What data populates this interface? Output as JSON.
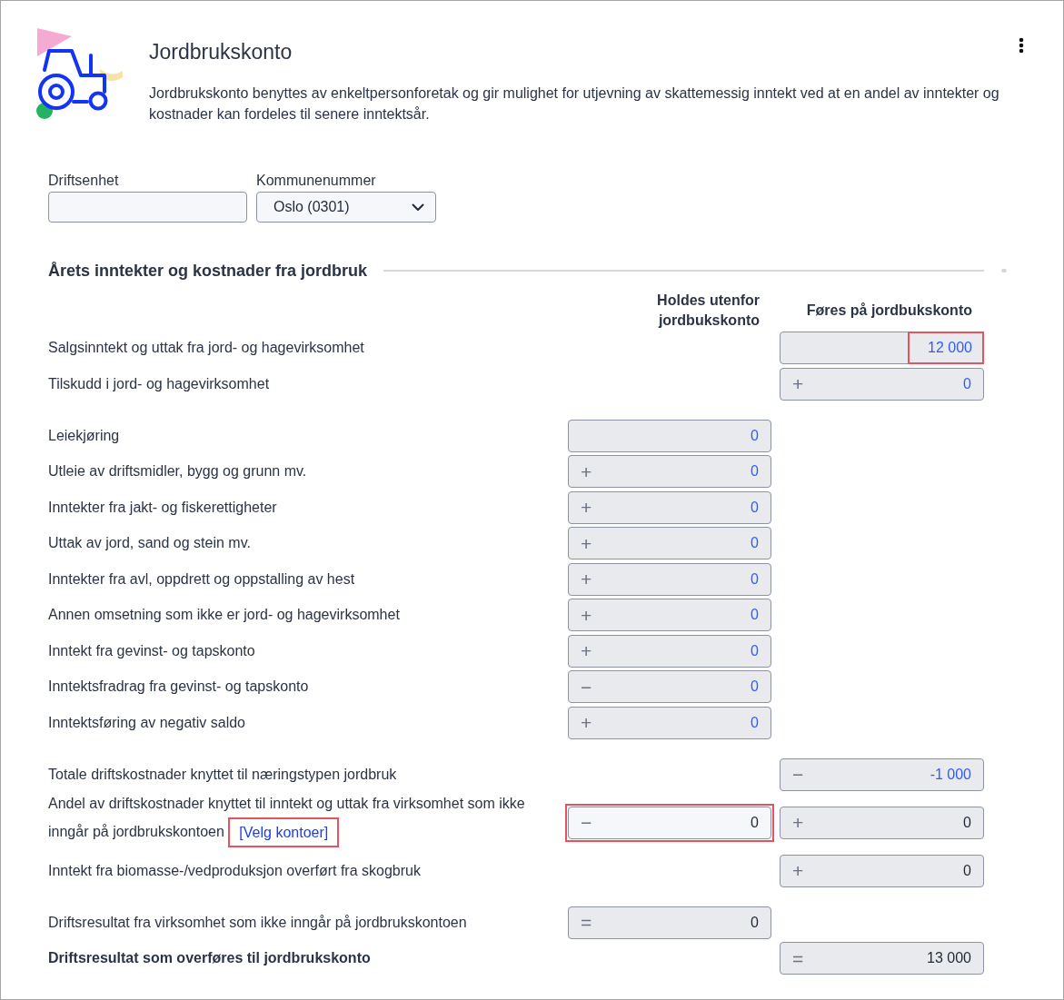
{
  "header": {
    "title": "Jordbrukskonto",
    "description": "Jordbrukskonto benyttes av enkeltpersonforetak og gir mulighet for utjevning av skattemessig inntekt ved at en andel av inntekter og kostnader kan fordeles til senere inntektsår."
  },
  "fields": [
    {
      "kind": "input",
      "label": "Driftsenhet"
    },
    {
      "kind": "select",
      "label": "Kommunenummer",
      "value": "Oslo (0301)"
    }
  ],
  "section": {
    "title": "Årets inntekter og kostnader fra jordbruk",
    "columns": [
      "Holdes utenfor jordbukskonto",
      "Føres på jordbukskonto"
    ],
    "groups": [
      {
        "rows": [
          {
            "kind": "line",
            "label": "Salgsinntekt og uttak fra jord- og hagevirksomhet",
            "right": {
              "value": "12 000",
              "linked": true,
              "focused": false,
              "highlighted": false,
              "value_highlighted": true
            }
          },
          {
            "kind": "line",
            "label": "Tilskudd i jord- og hagevirksomhet",
            "right": {
              "op": "+",
              "value": "0",
              "linked": true,
              "focused": false,
              "highlighted": false,
              "value_highlighted": false
            }
          }
        ]
      },
      {
        "rows": [
          {
            "kind": "line",
            "label": "Leiekjøring",
            "left": {
              "value": "0",
              "linked": true,
              "focused": false,
              "highlighted": false,
              "value_highlighted": false
            }
          },
          {
            "kind": "line",
            "label": "Utleie av driftsmidler, bygg og grunn mv.",
            "left": {
              "op": "+",
              "value": "0",
              "linked": true,
              "focused": false,
              "highlighted": false,
              "value_highlighted": false
            }
          },
          {
            "kind": "line",
            "label": "Inntekter fra jakt- og fiskerettigheter",
            "left": {
              "op": "+",
              "value": "0",
              "linked": true,
              "focused": false,
              "highlighted": false,
              "value_highlighted": false
            }
          },
          {
            "kind": "line",
            "label": "Uttak av jord, sand og stein mv.",
            "left": {
              "op": "+",
              "value": "0",
              "linked": true,
              "focused": false,
              "highlighted": false,
              "value_highlighted": false
            }
          },
          {
            "kind": "line",
            "label": "Inntekter fra avl, oppdrett og oppstalling av hest",
            "left": {
              "op": "+",
              "value": "0",
              "linked": true,
              "focused": false,
              "highlighted": false,
              "value_highlighted": false
            }
          },
          {
            "kind": "line",
            "label": "Annen omsetning som ikke er jord- og hagevirksomhet",
            "left": {
              "op": "+",
              "value": "0",
              "linked": true,
              "focused": false,
              "highlighted": false,
              "value_highlighted": false
            }
          },
          {
            "kind": "line",
            "label": "Inntekt fra gevinst- og tapskonto",
            "left": {
              "op": "+",
              "value": "0",
              "linked": true,
              "focused": false,
              "highlighted": false,
              "value_highlighted": false
            }
          },
          {
            "kind": "line",
            "label": "Inntektsfradrag fra gevinst- og tapskonto",
            "left": {
              "op": "−",
              "value": "0",
              "linked": true,
              "focused": false,
              "highlighted": false,
              "value_highlighted": false
            }
          },
          {
            "kind": "line",
            "label": "Inntektsføring av negativ saldo",
            "left": {
              "op": "+",
              "value": "0",
              "linked": true,
              "focused": false,
              "highlighted": false,
              "value_highlighted": false
            }
          }
        ]
      },
      {
        "rows": [
          {
            "kind": "line",
            "label": "Totale driftskostnader knyttet til næringstypen jordbruk",
            "right": {
              "op": "−",
              "value": "-1 000",
              "linked": true,
              "focused": false,
              "highlighted": false,
              "value_highlighted": false
            }
          },
          {
            "kind": "line",
            "label": "Andel av driftskostnader knyttet til inntekt og uttak fra virksomhet som ikke inngår på jordbrukskontoen",
            "link": {
              "text": "[Velg kontoer]",
              "highlighted": true
            },
            "left": {
              "op": "−",
              "value": "0",
              "linked": false,
              "focused": true,
              "highlighted": true,
              "value_highlighted": false
            },
            "right": {
              "op": "+",
              "value": "0",
              "linked": false,
              "focused": false,
              "highlighted": false,
              "value_highlighted": false
            }
          },
          {
            "kind": "line",
            "label": "Inntekt fra biomasse-/vedproduksjon overført fra skogbruk",
            "right": {
              "op": "+",
              "value": "0",
              "linked": false,
              "focused": false,
              "highlighted": false,
              "value_highlighted": false
            }
          }
        ]
      },
      {
        "rows": [
          {
            "kind": "line",
            "label": "Driftsresultat fra virksomhet som ikke inngår på jordbrukskontoen",
            "left": {
              "op": "=",
              "value": "0",
              "linked": false,
              "focused": false,
              "highlighted": false,
              "value_highlighted": false
            }
          },
          {
            "kind": "total",
            "label": "Driftsresultat som overføres til jordbrukskonto",
            "right": {
              "op": "=",
              "value": "13 000",
              "linked": false,
              "focused": false,
              "highlighted": false,
              "value_highlighted": false
            }
          }
        ]
      }
    ]
  }
}
